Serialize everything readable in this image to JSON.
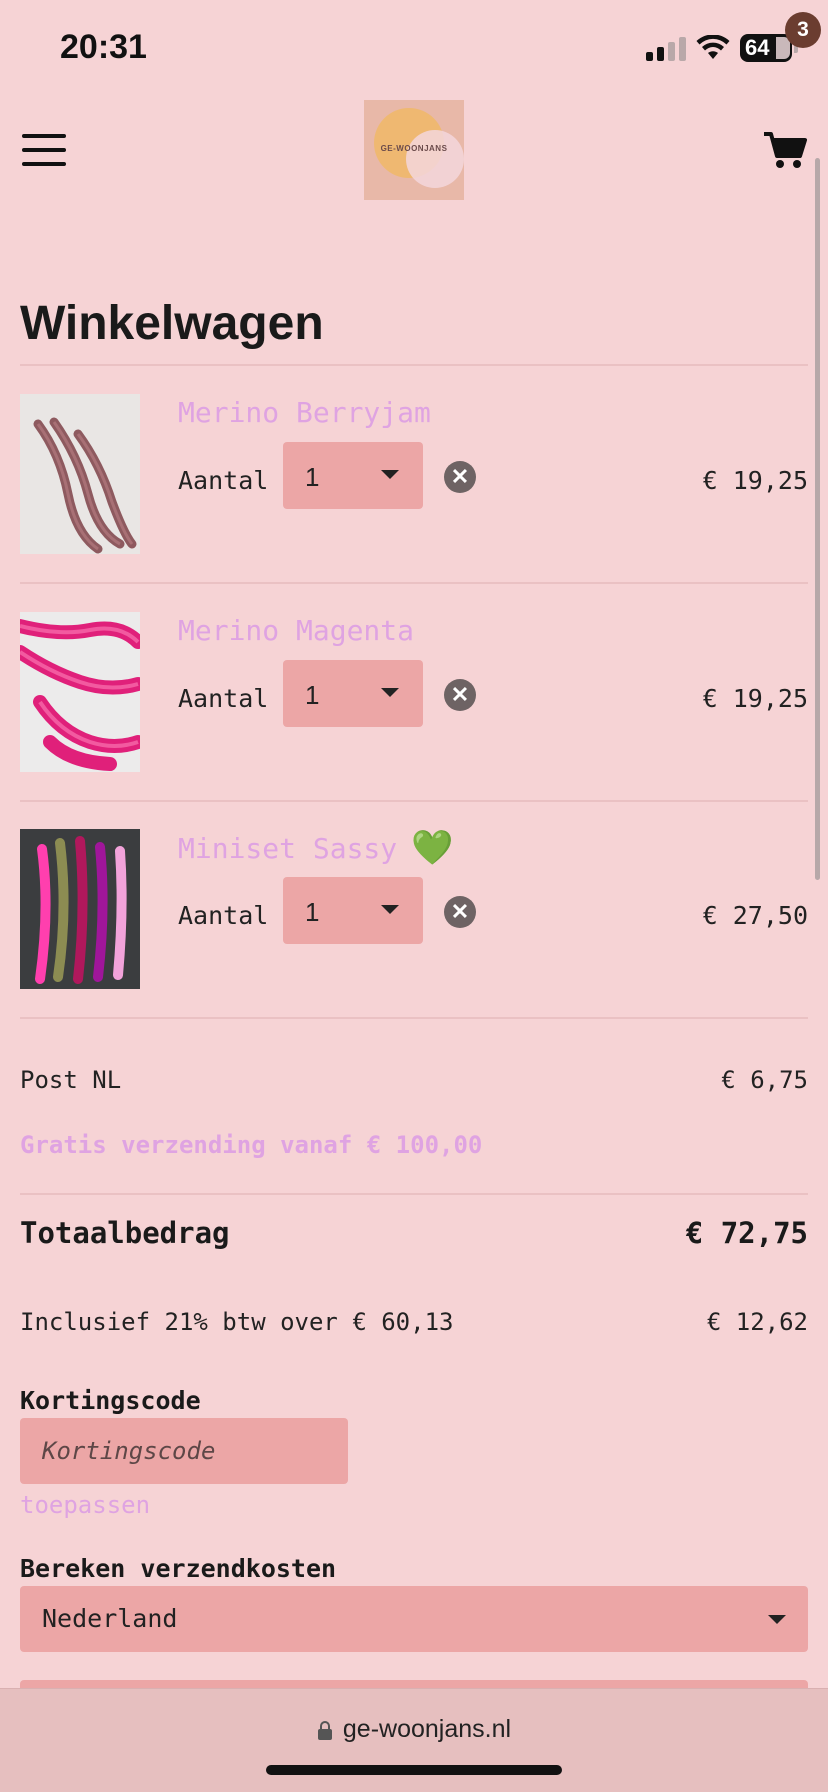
{
  "status_bar": {
    "time": "20:31",
    "battery": "64"
  },
  "header": {
    "logo_text": "GE-WOONJANS",
    "cart_count": "3"
  },
  "page": {
    "title": "Winkelwagen"
  },
  "cart": {
    "qty_label": "Aantal",
    "items": [
      {
        "name": "Merino Berryjam",
        "quantity": "1",
        "price": "€ 19,25",
        "emoji": ""
      },
      {
        "name": "Merino Magenta",
        "quantity": "1",
        "price": "€ 19,25",
        "emoji": ""
      },
      {
        "name": "Miniset Sassy",
        "quantity": "1",
        "price": "€ 27,50",
        "emoji": "💚"
      }
    ]
  },
  "shipping": {
    "method": "Post NL",
    "cost": "€ 6,75",
    "free_note": "Gratis verzending vanaf € 100,00"
  },
  "totals": {
    "label": "Totaalbedrag",
    "value": "€ 72,75",
    "vat_label": "Inclusief 21% btw over € 60,13",
    "vat_value": "€ 12,62"
  },
  "coupon": {
    "label": "Kortingscode",
    "placeholder": "Kortingscode",
    "apply": "toepassen"
  },
  "shipping_calc": {
    "label": "Bereken verzendkosten",
    "country": "Nederland"
  },
  "browser": {
    "url": "ge-woonjans.nl"
  }
}
